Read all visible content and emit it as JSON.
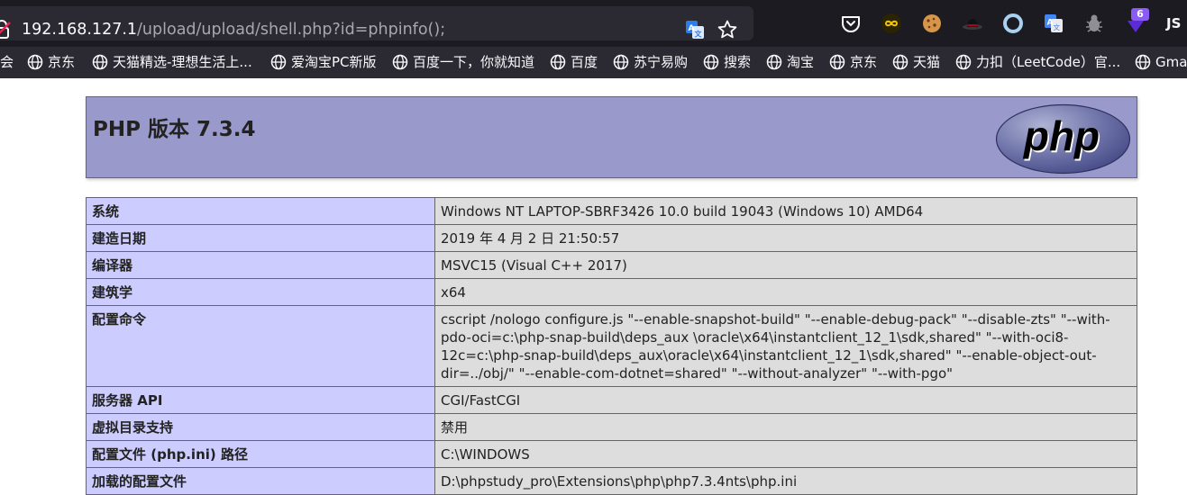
{
  "browser": {
    "url_host": "192.168.127.1",
    "url_path": "/upload/upload/shell.php?id=phpinfo();",
    "extension_badge": "6",
    "js_extension_label": "JS",
    "colors": {
      "chrome_bg": "#1c1b22",
      "toolbar_bg": "#2b2a33",
      "accent_badge": "#8a5cf5"
    }
  },
  "bookmarks": [
    {
      "label": "会"
    },
    {
      "label": "京东"
    },
    {
      "label": "天猫精选-理想生活上..."
    },
    {
      "label": "爱淘宝PC新版"
    },
    {
      "label": "百度一下，你就知道"
    },
    {
      "label": "百度"
    },
    {
      "label": "苏宁易购"
    },
    {
      "label": "搜索"
    },
    {
      "label": "淘宝"
    },
    {
      "label": "京东"
    },
    {
      "label": "天猫"
    },
    {
      "label": "力扣（LeetCode）官..."
    },
    {
      "label": "Gma"
    }
  ],
  "phpinfo": {
    "title": "PHP 版本 7.3.4",
    "logo_text": "php",
    "colors": {
      "header_bg": "#9999cc",
      "key_bg": "#ccccff",
      "value_bg": "#dddddd"
    },
    "rows": [
      {
        "key": "系统",
        "value": "Windows NT LAPTOP-SBRF3426 10.0 build 19043 (Windows 10) AMD64"
      },
      {
        "key": "建造日期",
        "value": "2019 年 4 月 2 日 21:50:57"
      },
      {
        "key": "编译器",
        "value": "MSVC15 (Visual C++ 2017)"
      },
      {
        "key": "建筑学",
        "value": "x64"
      },
      {
        "key": "配置命令",
        "value": "cscript /nologo configure.js \"--enable-snapshot-build\" \"--enable-debug-pack\" \"--disable-zts\" \"--with-pdo-oci=c:\\php-snap-build\\deps_aux \\oracle\\x64\\instantclient_12_1\\sdk,shared\" \"--with-oci8-12c=c:\\php-snap-build\\deps_aux\\oracle\\x64\\instantclient_12_1\\sdk,shared\" \"--enable-object-out- dir=../obj/\" \"--enable-com-dotnet=shared\" \"--without-analyzer\" \"--with-pgo\""
      },
      {
        "key": "服务器 API",
        "value": "CGI/FastCGI"
      },
      {
        "key": "虚拟目录支持",
        "value": "禁用"
      },
      {
        "key": "配置文件 (php.ini) 路径",
        "value": "C:\\WINDOWS"
      },
      {
        "key": "加载的配置文件",
        "value": "D:\\phpstudy_pro\\Extensions\\php\\php7.3.4nts\\php.ini"
      }
    ]
  }
}
